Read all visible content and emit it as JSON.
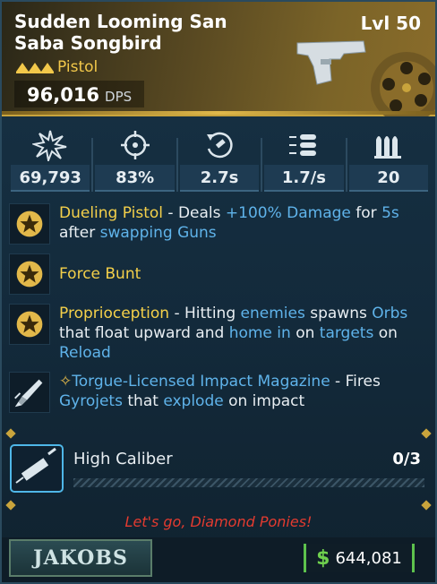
{
  "item": {
    "name": "Sudden Looming San Saba Songbird",
    "level": "Lvl 50",
    "type": "Pistol",
    "dps_value": "96,016",
    "dps_unit": "DPS",
    "rarity_color": "#f2c84a"
  },
  "stats": [
    {
      "icon": "damage-burst-icon",
      "value": "69,793"
    },
    {
      "icon": "accuracy-crosshair-icon",
      "value": "83%"
    },
    {
      "icon": "reload-time-icon",
      "value": "2.7s"
    },
    {
      "icon": "fire-rate-icon",
      "value": "1.7/s"
    },
    {
      "icon": "magazine-size-icon",
      "value": "20"
    }
  ],
  "perks": [
    {
      "icon": "star-badge-icon",
      "segments": [
        {
          "t": "Dueling Pistol",
          "c": "y"
        },
        {
          "t": " - Deals ",
          "c": ""
        },
        {
          "t": "+100% Damage",
          "c": "b"
        },
        {
          "t": " for ",
          "c": ""
        },
        {
          "t": "5s",
          "c": "b"
        },
        {
          "t": " after ",
          "c": ""
        },
        {
          "t": "swapping Guns",
          "c": "b"
        }
      ]
    },
    {
      "icon": "star-badge-icon",
      "segments": [
        {
          "t": "Force Bunt",
          "c": "y"
        }
      ]
    },
    {
      "icon": "star-badge-icon",
      "segments": [
        {
          "t": "Proprioception",
          "c": "y"
        },
        {
          "t": " - Hitting ",
          "c": ""
        },
        {
          "t": "enemies",
          "c": "b"
        },
        {
          "t": " spawns ",
          "c": ""
        },
        {
          "t": "Orbs",
          "c": "b"
        },
        {
          "t": " that float upward and ",
          "c": ""
        },
        {
          "t": "home in",
          "c": "b"
        },
        {
          "t": " on ",
          "c": ""
        },
        {
          "t": "targets",
          "c": "b"
        },
        {
          "t": " on ",
          "c": ""
        },
        {
          "t": "Reload",
          "c": "b"
        }
      ]
    },
    {
      "icon": "rocket-icon",
      "segments": [
        {
          "t": "Torgue-Licensed Impact Magazine",
          "c": "b"
        },
        {
          "t": " - Fires ",
          "c": ""
        },
        {
          "t": "Gyrojets",
          "c": "b"
        },
        {
          "t": " that ",
          "c": ""
        },
        {
          "t": "explode",
          "c": "b"
        },
        {
          "t": " on impact",
          "c": ""
        }
      ]
    }
  ],
  "underbarrel": {
    "label": "High Caliber",
    "count": "0/3",
    "progress": 0
  },
  "flavor": "Let's go, Diamond Ponies!",
  "footer": {
    "manufacturer": "JAKOBS",
    "currency_symbol": "$",
    "price": "644,081"
  }
}
